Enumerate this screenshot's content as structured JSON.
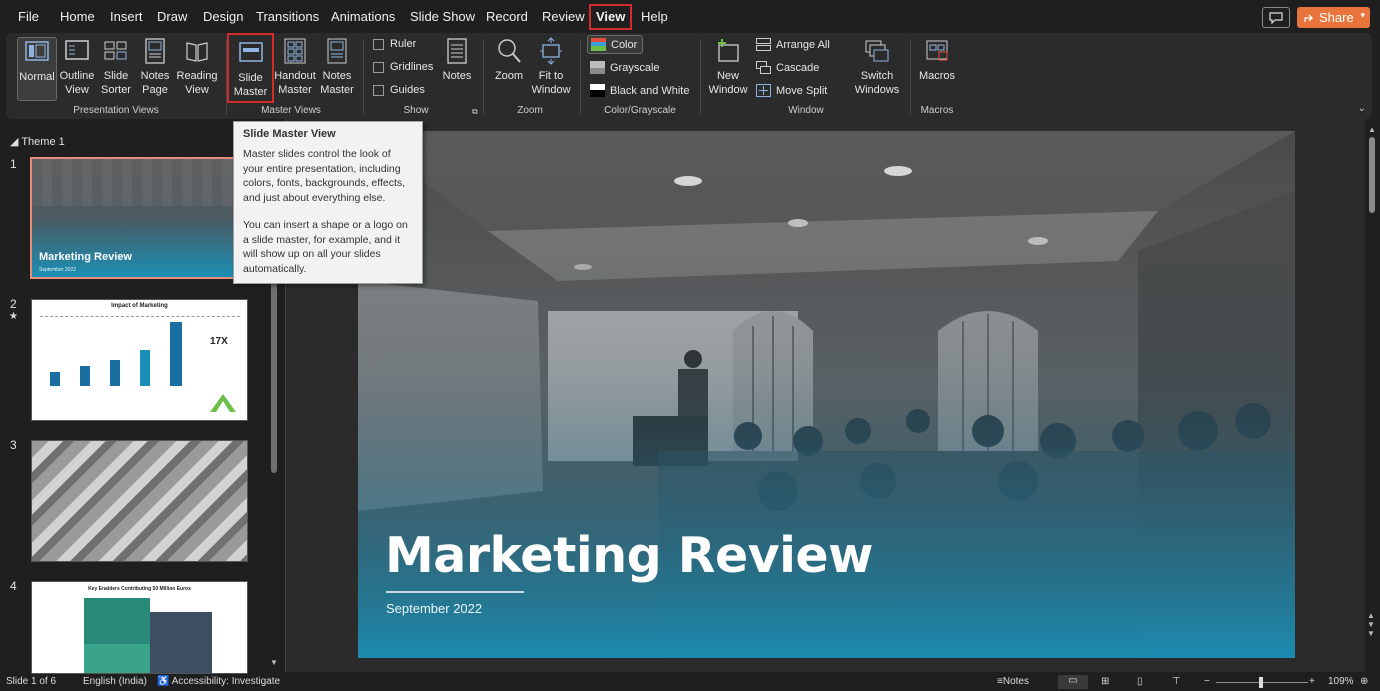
{
  "menu": [
    "File",
    "Home",
    "Insert",
    "Draw",
    "Design",
    "Transitions",
    "Animations",
    "Slide Show",
    "Record",
    "Review",
    "View",
    "Help"
  ],
  "share_label": "Share",
  "ribbon": {
    "presentation_views": {
      "label": "Presentation Views",
      "buttons": [
        "Normal",
        "Outline View",
        "Slide Sorter",
        "Notes Page",
        "Reading View"
      ]
    },
    "master_views": {
      "label": "Master Views",
      "buttons": [
        "Slide Master",
        "Handout Master",
        "Notes Master"
      ]
    },
    "show": {
      "label": "Show",
      "checks": [
        "Ruler",
        "Gridlines",
        "Guides"
      ],
      "notes": "Notes"
    },
    "zoom": {
      "label": "Zoom",
      "zoom": "Zoom",
      "fit": "Fit to Window"
    },
    "color": {
      "label": "Color/Grayscale",
      "items": [
        "Color",
        "Grayscale",
        "Black and White"
      ]
    },
    "window": {
      "label": "Window",
      "new_window": "New Window",
      "items": [
        "Arrange All",
        "Cascade",
        "Move Split"
      ],
      "switch": "Switch Windows"
    },
    "macros": {
      "label": "Macros",
      "button": "Macros"
    }
  },
  "thumbs": {
    "theme": "Theme 1",
    "slide1_title": "Marketing Review",
    "slide1_sub": "September 2022",
    "slide2_title": "Impact of Marketing",
    "slide2_big": "17X",
    "slide4_title": "Key Enablers Contributing 50 Million Euros"
  },
  "slide": {
    "title": "Marketing Review",
    "subtitle": "September 2022"
  },
  "tooltip": {
    "title": "Slide Master View",
    "p1": "Master slides control the look of your entire presentation, including colors, fonts, backgrounds, effects, and just about everything else.",
    "p2": "You can insert a shape or a logo on a slide master, for example, and it will show up on all your slides automatically."
  },
  "status": {
    "slide": "Slide 1 of 6",
    "language": "English (India)",
    "accessibility": "Accessibility: Investigate",
    "notes": "Notes",
    "zoom": "109%"
  },
  "colors": {
    "accent": "#d22b2b",
    "share": "#e8743b",
    "teal": "#1a8fb5"
  }
}
